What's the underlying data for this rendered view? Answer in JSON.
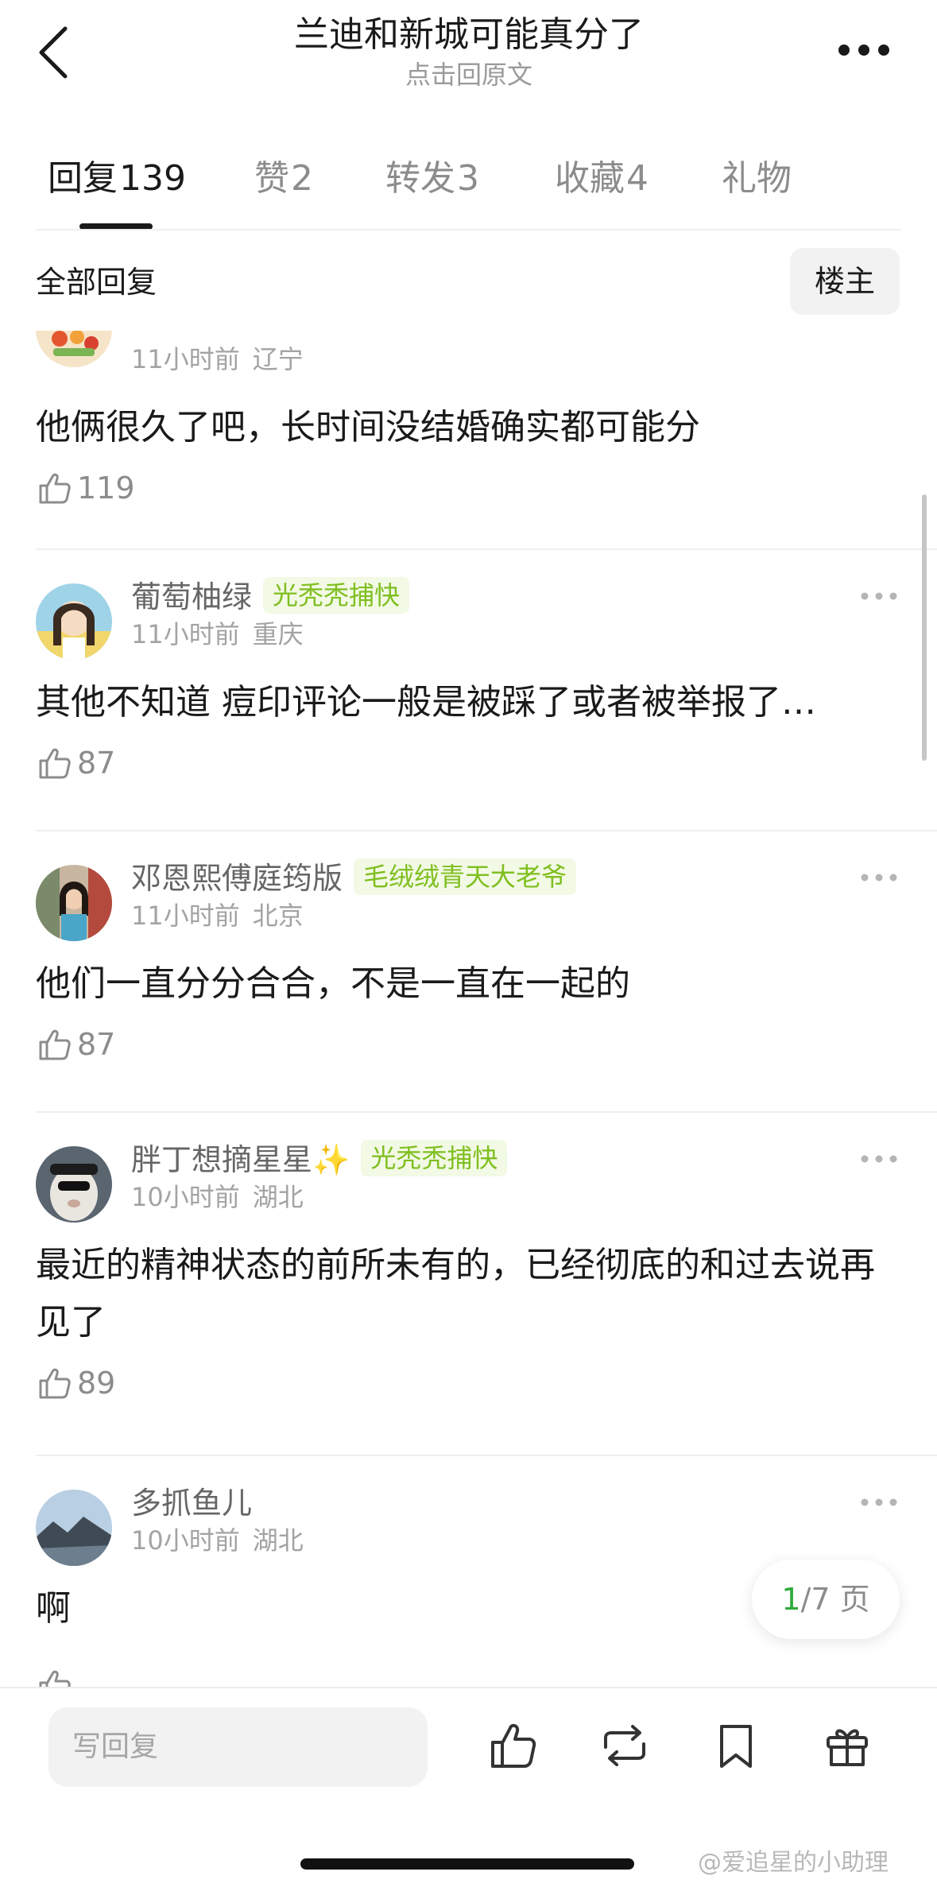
{
  "header": {
    "title": "兰迪和新城可能真分了",
    "subtitle": "点击回原文"
  },
  "tabs": [
    {
      "label": "回复",
      "count": "139",
      "active": true
    },
    {
      "label": "赞",
      "count": "2"
    },
    {
      "label": "转发",
      "count": "3"
    },
    {
      "label": "收藏",
      "count": "4"
    },
    {
      "label": "礼物",
      "count": ""
    }
  ],
  "filter": {
    "label": "全部回复",
    "owner_button": "楼主"
  },
  "comments": [
    {
      "time": "11小时前",
      "location": "辽宁",
      "text": "他俩很久了吧，长时间没结婚确实都可能分",
      "likes": "119"
    },
    {
      "username": "葡萄柚绿",
      "badge": "光秃秃捕快",
      "time": "11小时前",
      "location": "重庆",
      "text": "其他不知道 痘印评论一般是被踩了或者被举报了…",
      "likes": "87"
    },
    {
      "username": "邓恩熙傅庭筠版",
      "badge": "毛绒绒青天大老爷",
      "time": "11小时前",
      "location": "北京",
      "text": "他们一直分分合合，不是一直在一起的",
      "likes": "87"
    },
    {
      "username": "胖丁想摘星星✨",
      "badge": "光秃秃捕快",
      "time": "10小时前",
      "location": "湖北",
      "text": "最近的精神状态的前所未有的，已经彻底的和过去说再见了",
      "likes": "89"
    },
    {
      "username": "多抓鱼儿",
      "time": "10小时前",
      "location": "湖北",
      "text": "啊"
    }
  ],
  "pager": {
    "current": "1",
    "total_text": "/7 页"
  },
  "bottom_bar": {
    "reply_placeholder": "写回复"
  },
  "watermark": "@爱追星的小助理",
  "colors": {
    "accent_green": "#2eaa3c",
    "badge_text": "#7fbf1f",
    "badge_bg": "#f2f9e4"
  }
}
